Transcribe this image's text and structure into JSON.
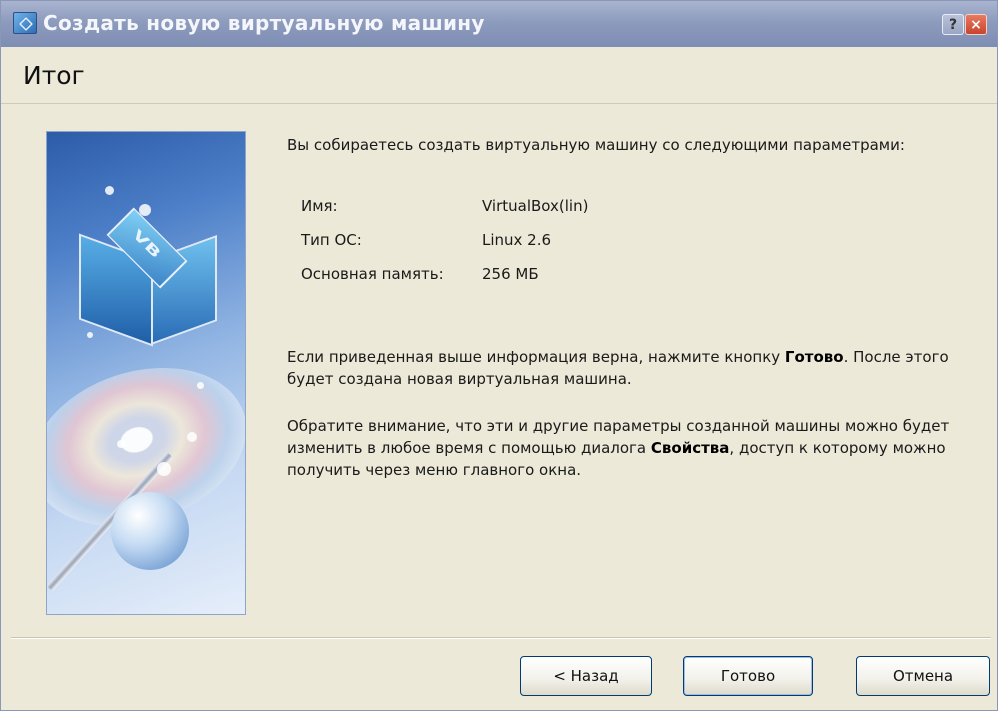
{
  "window": {
    "title": "Создать новую виртуальную машину",
    "help_label": "?",
    "close_label": "×"
  },
  "page": {
    "title": "Итог"
  },
  "summary": {
    "intro": "Вы собираетесь создать виртуальную машину со следующими параметрами:",
    "params": [
      {
        "label": "Имя:",
        "value": "VirtualBox(lin)"
      },
      {
        "label": "Тип ОС:",
        "value": "Linux 2.6"
      },
      {
        "label": "Основная память:",
        "value": "256 МБ"
      }
    ],
    "para1_before": "Если приведенная выше информация верна, нажмите кнопку ",
    "para1_bold": "Готово",
    "para1_after": ". После этого будет создана новая виртуальная машина.",
    "para2_before": "Обратите внимание, что эти и другие параметры созданной машины можно будет изменить в любое время с помощью диалога ",
    "para2_bold": "Свойства",
    "para2_after": ", доступ к которому можно получить через меню главного окна."
  },
  "buttons": {
    "back": "< Назад",
    "finish": "Готово",
    "cancel": "Отмена"
  }
}
